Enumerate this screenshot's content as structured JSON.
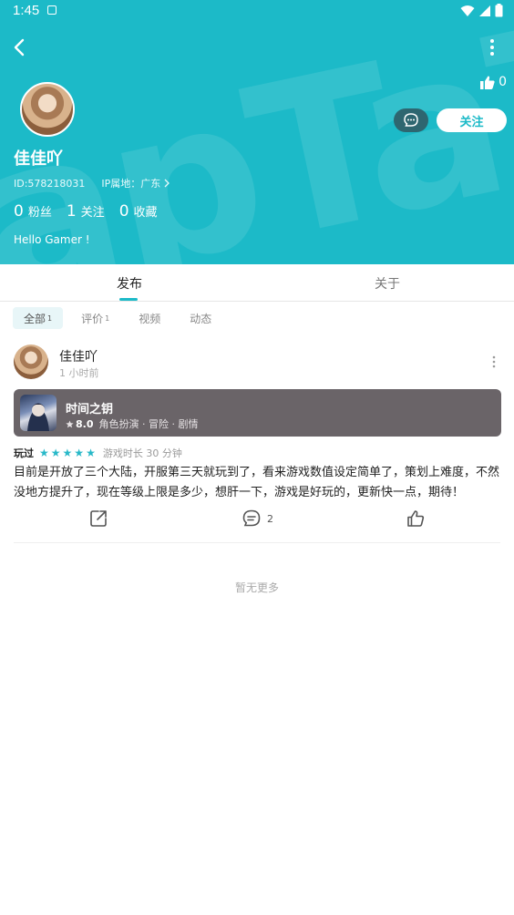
{
  "status_bar": {
    "time": "1:45"
  },
  "header": {
    "watermark": "apTaT",
    "like_count": "0",
    "follow_label": "关注",
    "user_name": "佳佳吖",
    "user_id": "ID:578218031",
    "ip_location": "IP属地：广东",
    "stats": [
      {
        "num": "0",
        "label": "粉丝"
      },
      {
        "num": "1",
        "label": "关注"
      },
      {
        "num": "0",
        "label": "收藏"
      }
    ],
    "bio": "Hello Gamer !"
  },
  "tabs": [
    {
      "label": "发布"
    },
    {
      "label": "关于"
    }
  ],
  "chips": [
    {
      "label": "全部",
      "count": "1"
    },
    {
      "label": "评价",
      "count": "1"
    },
    {
      "label": "视频",
      "count": ""
    },
    {
      "label": "动态",
      "count": ""
    }
  ],
  "post": {
    "author": "佳佳吖",
    "time": "1 小时前",
    "game": {
      "title": "时间之钥",
      "score": "8.0",
      "tags": "角色扮演 · 冒险 · 剧情"
    },
    "played_label": "玩过",
    "star_count": 5,
    "playtime": "游戏时长 30 分钟",
    "review": "目前是开放了三个大陆，开服第三天就玩到了，看来游戏数值设定简单了，策划上难度，不然没地方提升了，现在等级上限是多少，想肝一下，游戏是好玩的，更新快一点，期待！",
    "comment_count": "2"
  },
  "no_more": "暂无更多",
  "colors": {
    "accent": "#1cbac8",
    "message_button": "#2e6670",
    "game_card": "#6a6468"
  }
}
